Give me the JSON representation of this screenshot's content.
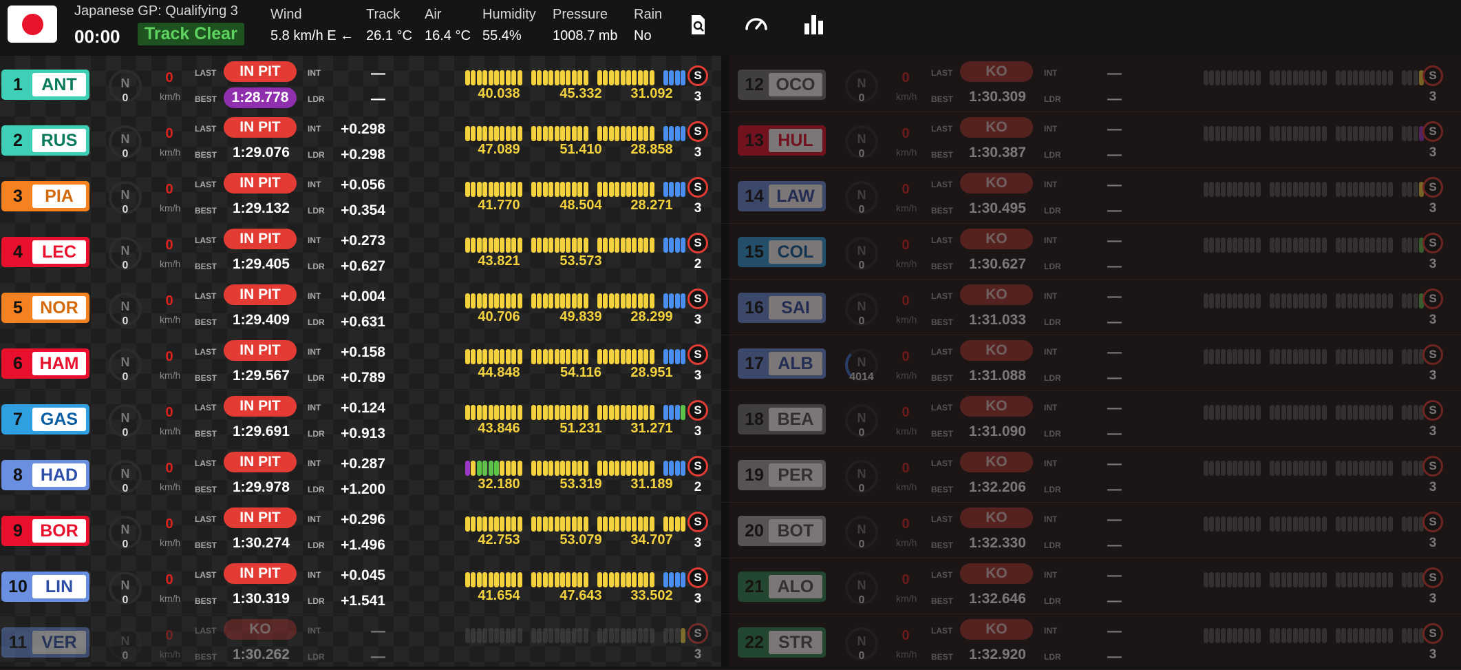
{
  "header": {
    "session": "Japanese GP: Qualifying 3",
    "clock": "00:00",
    "track_status": "Track Clear",
    "weather": [
      {
        "label": "Wind",
        "value": "5.8 km/h E ←"
      },
      {
        "label": "Track",
        "value": "26.1 °C"
      },
      {
        "label": "Air",
        "value": "16.4 °C"
      },
      {
        "label": "Humidity",
        "value": "55.4%"
      },
      {
        "label": "Pressure",
        "value": "1008.7 mb"
      },
      {
        "label": "Rain",
        "value": "No"
      }
    ],
    "icons": [
      "search-document-icon",
      "speedometer-icon",
      "bar-chart-icon"
    ]
  },
  "labels": {
    "last": "LAST",
    "best": "BEST",
    "int": "INT",
    "ldr": "LDR",
    "kmh": "km/h",
    "gear": "N"
  },
  "colors": {
    "sector_yellow": "#f3d23d",
    "sector_blue": "#4a8ff0",
    "sector_green": "#5cc24a",
    "sector_purple": "#9b38c7",
    "sector_grey": "#555555",
    "in_pit": "#e23c35",
    "track_clear": "#5fd35f"
  },
  "left_drivers": [
    {
      "pos": "1",
      "code": "ANT",
      "team_color": "#3ed0b6",
      "gear": "N",
      "rpm": "0",
      "speed": "0",
      "status": "IN PIT",
      "best": "1:28.778",
      "best_purple": true,
      "int": "—",
      "ldr": "—",
      "sectors": [
        "40.038",
        "45.332",
        "31.092"
      ],
      "tyre": "S",
      "laps": "3",
      "mini": "yyyyyyyyyyyyyyyyyyyyyyyyyyyyyybbbb"
    },
    {
      "pos": "2",
      "code": "RUS",
      "team_color": "#3ed0b6",
      "gear": "N",
      "rpm": "0",
      "speed": "0",
      "status": "IN PIT",
      "best": "1:29.076",
      "int": "+0.298",
      "ldr": "+0.298",
      "sectors": [
        "47.089",
        "51.410",
        "28.858"
      ],
      "tyre": "S",
      "laps": "3",
      "mini": "yyyyyyyyyyyyyyyyyyyyyyyyyyyyyybbbb"
    },
    {
      "pos": "3",
      "code": "PIA",
      "team_color": "#f5821f",
      "gear": "N",
      "rpm": "0",
      "speed": "0",
      "status": "IN PIT",
      "best": "1:29.132",
      "int": "+0.056",
      "ldr": "+0.354",
      "sectors": [
        "41.770",
        "48.504",
        "28.271"
      ],
      "tyre": "S",
      "laps": "3",
      "mini": "yyyyyyyyyyyyyyyyyyyyyyyyyyyyyybbbb"
    },
    {
      "pos": "4",
      "code": "LEC",
      "team_color": "#e8102c",
      "gear": "N",
      "rpm": "0",
      "speed": "0",
      "status": "IN PIT",
      "best": "1:29.405",
      "int": "+0.273",
      "ldr": "+0.627",
      "sectors": [
        "43.821",
        "53.573",
        ""
      ],
      "tyre": "S",
      "laps": "2",
      "mini": "yyyyyyyyyyyyyyyyyyyyyyyyyyyyyybbbb"
    },
    {
      "pos": "5",
      "code": "NOR",
      "team_color": "#f5821f",
      "gear": "N",
      "rpm": "0",
      "speed": "0",
      "status": "IN PIT",
      "best": "1:29.409",
      "int": "+0.004",
      "ldr": "+0.631",
      "sectors": [
        "40.706",
        "49.839",
        "28.299"
      ],
      "tyre": "S",
      "laps": "3",
      "mini": "yyyyyyyyyyyyyyyyyyyyyyyyyyyyyybbbb"
    },
    {
      "pos": "6",
      "code": "HAM",
      "team_color": "#e8102c",
      "gear": "N",
      "rpm": "0",
      "speed": "0",
      "status": "IN PIT",
      "best": "1:29.567",
      "int": "+0.158",
      "ldr": "+0.789",
      "sectors": [
        "44.848",
        "54.116",
        "28.951"
      ],
      "tyre": "S",
      "laps": "3",
      "mini": "yyyyyyyyyyyyyyyyyyyyyyyyyyyyyybbbb"
    },
    {
      "pos": "7",
      "code": "GAS",
      "team_color": "#2f9fe0",
      "gear": "N",
      "rpm": "0",
      "speed": "0",
      "status": "IN PIT",
      "best": "1:29.691",
      "int": "+0.124",
      "ldr": "+0.913",
      "sectors": [
        "43.846",
        "51.231",
        "31.271"
      ],
      "tyre": "S",
      "laps": "3",
      "mini": "yyyyyyyyyyyyyyyyyyyyyyyyyyyyyybbbg"
    },
    {
      "pos": "8",
      "code": "HAD",
      "team_color": "#6a8fe0",
      "gear": "N",
      "rpm": "0",
      "speed": "0",
      "status": "IN PIT",
      "best": "1:29.978",
      "int": "+0.287",
      "ldr": "+1.200",
      "sectors": [
        "32.180",
        "53.319",
        "31.189"
      ],
      "tyre": "S",
      "laps": "2",
      "mini": "pyggggyyyyyyyyyyyyyyyyyyyyyyyybbbb"
    },
    {
      "pos": "9",
      "code": "BOR",
      "team_color": "#e8102c",
      "gear": "N",
      "rpm": "0",
      "speed": "0",
      "status": "IN PIT",
      "best": "1:30.274",
      "int": "+0.296",
      "ldr": "+1.496",
      "sectors": [
        "42.753",
        "53.079",
        "34.707"
      ],
      "tyre": "S",
      "laps": "3",
      "mini": "yyyyyyyyyyyyyyyyyyyyyyyyyyyyyyyyyy"
    },
    {
      "pos": "10",
      "code": "LIN",
      "team_color": "#6a8fe0",
      "gear": "N",
      "rpm": "0",
      "speed": "0",
      "status": "IN PIT",
      "best": "1:30.319",
      "int": "+0.045",
      "ldr": "+1.541",
      "sectors": [
        "41.654",
        "47.643",
        "33.502"
      ],
      "tyre": "S",
      "laps": "3",
      "mini": "yyyyyyyyyyyyyyyyyyyyyyyyyyyyyybbbb"
    },
    {
      "pos": "11",
      "code": "VER",
      "team_color": "#6a8fe0",
      "gear": "N",
      "rpm": "0",
      "speed": "0",
      "status": "KO",
      "best": "1:30.262",
      "int": "—",
      "ldr": "—",
      "sectors": [
        "",
        "",
        ""
      ],
      "tyre": "S",
      "laps": "3",
      "mini": "nnnnnnnnnnnnnnnnnnnnnnnnnnnnnnnnny",
      "out": true
    }
  ],
  "right_drivers": [
    {
      "pos": "12",
      "code": "OCO",
      "team_color": "#777777",
      "gear": "N",
      "rpm": "0",
      "speed": "0",
      "status": "KO",
      "best": "1:30.309",
      "int": "—",
      "ldr": "—",
      "tyre": "S",
      "laps": "3",
      "mark": "y"
    },
    {
      "pos": "13",
      "code": "HUL",
      "team_color": "#e8102c",
      "gear": "N",
      "rpm": "0",
      "speed": "0",
      "status": "KO",
      "best": "1:30.387",
      "int": "—",
      "ldr": "—",
      "tyre": "S",
      "laps": "3",
      "mark": "p"
    },
    {
      "pos": "14",
      "code": "LAW",
      "team_color": "#6a8fe0",
      "gear": "N",
      "rpm": "0",
      "speed": "0",
      "status": "KO",
      "best": "1:30.495",
      "int": "—",
      "ldr": "—",
      "tyre": "S",
      "laps": "3",
      "mark": "y"
    },
    {
      "pos": "15",
      "code": "COL",
      "team_color": "#2f9fe0",
      "gear": "N",
      "rpm": "0",
      "speed": "0",
      "status": "KO",
      "best": "1:30.627",
      "int": "—",
      "ldr": "—",
      "tyre": "S",
      "laps": "3",
      "mark": "g"
    },
    {
      "pos": "16",
      "code": "SAI",
      "team_color": "#6a8fe0",
      "gear": "N",
      "rpm": "0",
      "speed": "0",
      "status": "KO",
      "best": "1:31.033",
      "int": "—",
      "ldr": "—",
      "tyre": "S",
      "laps": "3",
      "mark": "g"
    },
    {
      "pos": "17",
      "code": "ALB",
      "team_color": "#6a8fe0",
      "gear": "N",
      "rpm": "4014",
      "speed": "0",
      "status": "KO",
      "best": "1:31.088",
      "int": "—",
      "ldr": "—",
      "tyre": "S",
      "laps": "3",
      "mark": "n"
    },
    {
      "pos": "18",
      "code": "BEA",
      "team_color": "#777777",
      "gear": "N",
      "rpm": "0",
      "speed": "0",
      "status": "KO",
      "best": "1:31.090",
      "int": "—",
      "ldr": "—",
      "tyre": "S",
      "laps": "3",
      "mark": "n"
    },
    {
      "pos": "19",
      "code": "PER",
      "team_color": "#aaaaaa",
      "gear": "N",
      "rpm": "0",
      "speed": "0",
      "status": "KO",
      "best": "1:32.206",
      "int": "—",
      "ldr": "—",
      "tyre": "S",
      "laps": "3",
      "mark": "n"
    },
    {
      "pos": "20",
      "code": "BOT",
      "team_color": "#aaaaaa",
      "gear": "N",
      "rpm": "0",
      "speed": "0",
      "status": "KO",
      "best": "1:32.330",
      "int": "—",
      "ldr": "—",
      "tyre": "S",
      "laps": "3",
      "mark": "n"
    },
    {
      "pos": "21",
      "code": "ALO",
      "team_color": "#2e8b57",
      "gear": "N",
      "rpm": "0",
      "speed": "0",
      "status": "KO",
      "best": "1:32.646",
      "int": "—",
      "ldr": "—",
      "tyre": "S",
      "laps": "3",
      "mark": "n"
    },
    {
      "pos": "22",
      "code": "STR",
      "team_color": "#2e8b57",
      "gear": "N",
      "rpm": "0",
      "speed": "0",
      "status": "KO",
      "best": "1:32.920",
      "int": "—",
      "ldr": "—",
      "tyre": "S",
      "laps": "3",
      "mark": "n"
    }
  ]
}
